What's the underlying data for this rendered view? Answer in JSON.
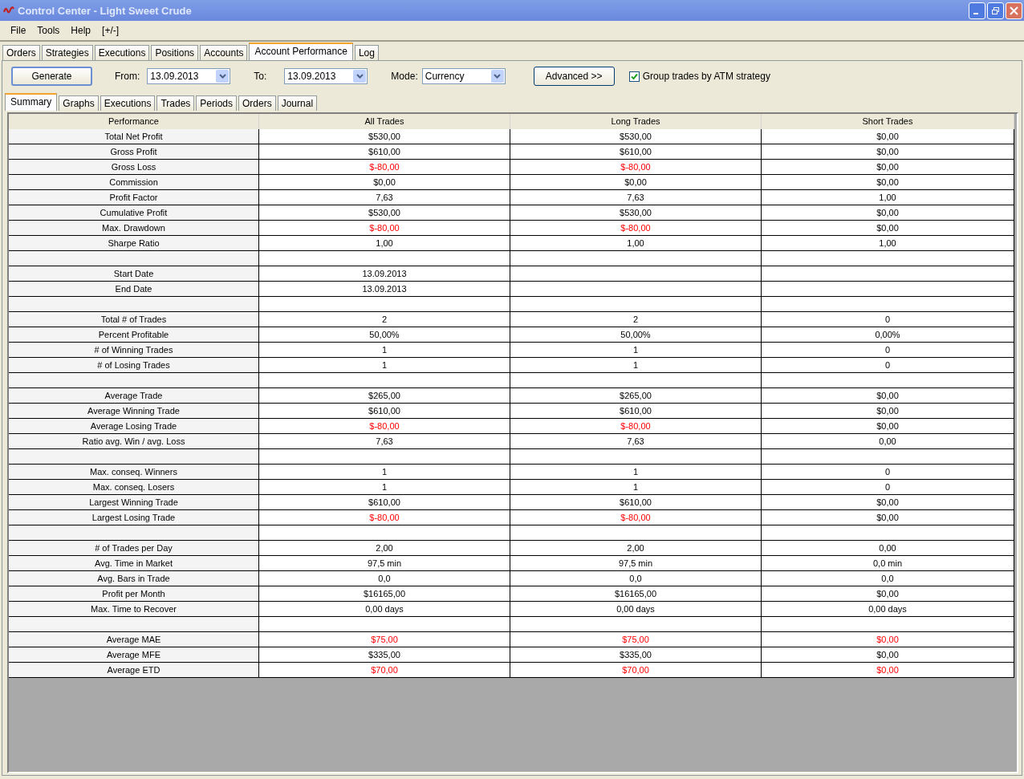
{
  "window": {
    "title": "Control Center - Light Sweet Crude"
  },
  "menu": [
    "File",
    "Tools",
    "Help",
    "[+/-]"
  ],
  "tabs": [
    {
      "label": "Orders",
      "selected": false
    },
    {
      "label": "Strategies",
      "selected": false
    },
    {
      "label": "Executions",
      "selected": false
    },
    {
      "label": "Positions",
      "selected": false
    },
    {
      "label": "Accounts",
      "selected": false
    },
    {
      "label": "Account Performance",
      "selected": true
    },
    {
      "label": "Log",
      "selected": false
    }
  ],
  "toolbar": {
    "generate": "Generate",
    "from_label": "From:",
    "from_value": "13.09.2013",
    "to_label": "To:",
    "to_value": "13.09.2013",
    "mode_label": "Mode:",
    "mode_value": "Currency",
    "advanced": "Advanced >>",
    "group_trades": {
      "label": "Group trades by ATM strategy",
      "checked": true
    }
  },
  "subtabs": [
    {
      "label": "Summary",
      "selected": true
    },
    {
      "label": "Graphs",
      "selected": false
    },
    {
      "label": "Executions",
      "selected": false
    },
    {
      "label": "Trades",
      "selected": false
    },
    {
      "label": "Periods",
      "selected": false
    },
    {
      "label": "Orders",
      "selected": false
    },
    {
      "label": "Journal",
      "selected": false
    }
  ],
  "table": {
    "columns": [
      "Performance",
      "All Trades",
      "Long Trades",
      "Short Trades"
    ],
    "rows": [
      {
        "kind": "data",
        "label": "Total Net Profit",
        "cells": [
          {
            "text": "$530,00",
            "negative": false
          },
          {
            "text": "$530,00",
            "negative": false
          },
          {
            "text": "$0,00",
            "negative": false
          }
        ]
      },
      {
        "kind": "data",
        "label": "Gross Profit",
        "cells": [
          {
            "text": "$610,00",
            "negative": false
          },
          {
            "text": "$610,00",
            "negative": false
          },
          {
            "text": "$0,00",
            "negative": false
          }
        ]
      },
      {
        "kind": "data",
        "label": "Gross Loss",
        "cells": [
          {
            "text": "$-80,00",
            "negative": true
          },
          {
            "text": "$-80,00",
            "negative": true
          },
          {
            "text": "$0,00",
            "negative": false
          }
        ]
      },
      {
        "kind": "data",
        "label": "Commission",
        "cells": [
          {
            "text": "$0,00",
            "negative": false
          },
          {
            "text": "$0,00",
            "negative": false
          },
          {
            "text": "$0,00",
            "negative": false
          }
        ]
      },
      {
        "kind": "data",
        "label": "Profit Factor",
        "cells": [
          {
            "text": "7,63",
            "negative": false
          },
          {
            "text": "7,63",
            "negative": false
          },
          {
            "text": "1,00",
            "negative": false
          }
        ]
      },
      {
        "kind": "data",
        "label": "Cumulative Profit",
        "cells": [
          {
            "text": "$530,00",
            "negative": false
          },
          {
            "text": "$530,00",
            "negative": false
          },
          {
            "text": "$0,00",
            "negative": false
          }
        ]
      },
      {
        "kind": "data",
        "label": "Max. Drawdown",
        "cells": [
          {
            "text": "$-80,00",
            "negative": true
          },
          {
            "text": "$-80,00",
            "negative": true
          },
          {
            "text": "$0,00",
            "negative": false
          }
        ]
      },
      {
        "kind": "data",
        "label": "Sharpe Ratio",
        "cells": [
          {
            "text": "1,00",
            "negative": false
          },
          {
            "text": "1,00",
            "negative": false
          },
          {
            "text": "1,00",
            "negative": false
          }
        ]
      },
      {
        "kind": "spacer"
      },
      {
        "kind": "data",
        "label": "Start Date",
        "cells": [
          {
            "text": "13.09.2013",
            "negative": false
          }
        ]
      },
      {
        "kind": "data",
        "label": "End Date",
        "cells": [
          {
            "text": "13.09.2013",
            "negative": false
          }
        ]
      },
      {
        "kind": "spacer"
      },
      {
        "kind": "data",
        "label": "Total # of Trades",
        "cells": [
          {
            "text": "2",
            "negative": false
          },
          {
            "text": "2",
            "negative": false
          },
          {
            "text": "0",
            "negative": false
          }
        ]
      },
      {
        "kind": "data",
        "label": "Percent Profitable",
        "cells": [
          {
            "text": "50,00%",
            "negative": false
          },
          {
            "text": "50,00%",
            "negative": false
          },
          {
            "text": "0,00%",
            "negative": false
          }
        ]
      },
      {
        "kind": "data",
        "label": "# of Winning Trades",
        "cells": [
          {
            "text": "1",
            "negative": false
          },
          {
            "text": "1",
            "negative": false
          },
          {
            "text": "0",
            "negative": false
          }
        ]
      },
      {
        "kind": "data",
        "label": "# of Losing Trades",
        "cells": [
          {
            "text": "1",
            "negative": false
          },
          {
            "text": "1",
            "negative": false
          },
          {
            "text": "0",
            "negative": false
          }
        ]
      },
      {
        "kind": "spacer"
      },
      {
        "kind": "data",
        "label": "Average Trade",
        "cells": [
          {
            "text": "$265,00",
            "negative": false
          },
          {
            "text": "$265,00",
            "negative": false
          },
          {
            "text": "$0,00",
            "negative": false
          }
        ]
      },
      {
        "kind": "data",
        "label": "Average Winning Trade",
        "cells": [
          {
            "text": "$610,00",
            "negative": false
          },
          {
            "text": "$610,00",
            "negative": false
          },
          {
            "text": "$0,00",
            "negative": false
          }
        ]
      },
      {
        "kind": "data",
        "label": "Average Losing Trade",
        "cells": [
          {
            "text": "$-80,00",
            "negative": true
          },
          {
            "text": "$-80,00",
            "negative": true
          },
          {
            "text": "$0,00",
            "negative": false
          }
        ]
      },
      {
        "kind": "data",
        "label": "Ratio avg. Win / avg. Loss",
        "cells": [
          {
            "text": "7,63",
            "negative": false
          },
          {
            "text": "7,63",
            "negative": false
          },
          {
            "text": "0,00",
            "negative": false
          }
        ]
      },
      {
        "kind": "spacer"
      },
      {
        "kind": "data",
        "label": "Max. conseq. Winners",
        "cells": [
          {
            "text": "1",
            "negative": false
          },
          {
            "text": "1",
            "negative": false
          },
          {
            "text": "0",
            "negative": false
          }
        ]
      },
      {
        "kind": "data",
        "label": "Max. conseq. Losers",
        "cells": [
          {
            "text": "1",
            "negative": false
          },
          {
            "text": "1",
            "negative": false
          },
          {
            "text": "0",
            "negative": false
          }
        ]
      },
      {
        "kind": "data",
        "label": "Largest Winning Trade",
        "cells": [
          {
            "text": "$610,00",
            "negative": false
          },
          {
            "text": "$610,00",
            "negative": false
          },
          {
            "text": "$0,00",
            "negative": false
          }
        ]
      },
      {
        "kind": "data",
        "label": "Largest Losing Trade",
        "cells": [
          {
            "text": "$-80,00",
            "negative": true
          },
          {
            "text": "$-80,00",
            "negative": true
          },
          {
            "text": "$0,00",
            "negative": false
          }
        ]
      },
      {
        "kind": "spacer"
      },
      {
        "kind": "data",
        "label": "# of Trades per Day",
        "cells": [
          {
            "text": "2,00",
            "negative": false
          },
          {
            "text": "2,00",
            "negative": false
          },
          {
            "text": "0,00",
            "negative": false
          }
        ]
      },
      {
        "kind": "data",
        "label": "Avg. Time in Market",
        "cells": [
          {
            "text": "97,5 min",
            "negative": false
          },
          {
            "text": "97,5 min",
            "negative": false
          },
          {
            "text": "0,0 min",
            "negative": false
          }
        ]
      },
      {
        "kind": "data",
        "label": "Avg. Bars in Trade",
        "cells": [
          {
            "text": "0,0",
            "negative": false
          },
          {
            "text": "0,0",
            "negative": false
          },
          {
            "text": "0,0",
            "negative": false
          }
        ]
      },
      {
        "kind": "data",
        "label": "Profit per Month",
        "cells": [
          {
            "text": "$16165,00",
            "negative": false
          },
          {
            "text": "$16165,00",
            "negative": false
          },
          {
            "text": "$0,00",
            "negative": false
          }
        ]
      },
      {
        "kind": "data",
        "label": "Max. Time to Recover",
        "cells": [
          {
            "text": "0,00 days",
            "negative": false
          },
          {
            "text": "0,00 days",
            "negative": false
          },
          {
            "text": "0,00 days",
            "negative": false
          }
        ]
      },
      {
        "kind": "spacer"
      },
      {
        "kind": "data",
        "label": "Average MAE",
        "cells": [
          {
            "text": "$75,00",
            "negative": true
          },
          {
            "text": "$75,00",
            "negative": true
          },
          {
            "text": "$0,00",
            "negative": true
          }
        ]
      },
      {
        "kind": "data",
        "label": "Average MFE",
        "cells": [
          {
            "text": "$335,00",
            "negative": false
          },
          {
            "text": "$335,00",
            "negative": false
          },
          {
            "text": "$0,00",
            "negative": false
          }
        ]
      },
      {
        "kind": "data",
        "label": "Average ETD",
        "cells": [
          {
            "text": "$70,00",
            "negative": true
          },
          {
            "text": "$70,00",
            "negative": true
          },
          {
            "text": "$0,00",
            "negative": true
          }
        ]
      }
    ]
  }
}
